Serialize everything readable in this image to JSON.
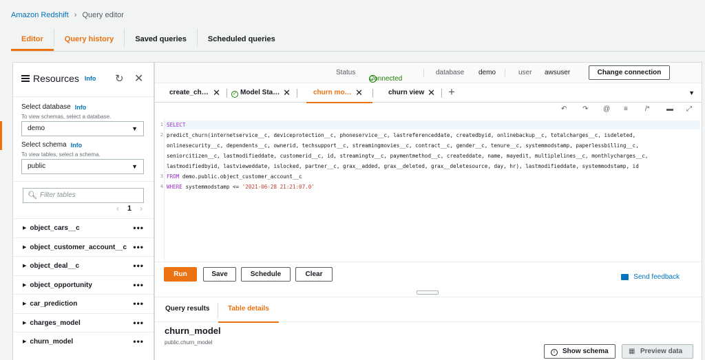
{
  "breadcrumb": {
    "parent": "Amazon Redshift",
    "separator": "›",
    "current": "Query editor"
  },
  "top_tabs": [
    "Editor",
    "Query history",
    "Saved queries",
    "Scheduled queries"
  ],
  "resources": {
    "title": "Resources",
    "info": "Info",
    "select_database_label": "Select database",
    "select_database_desc": "To view schemas, select a database.",
    "database_value": "demo",
    "select_schema_label": "Select schema",
    "select_schema_desc": "To view tables, select a schema.",
    "schema_value": "public",
    "filter_placeholder": "Filter tables",
    "page": "1",
    "tables": [
      "object_cars__c",
      "object_customer_account__c",
      "object_deal__c",
      "object_opportunity",
      "car_prediction",
      "charges_model",
      "churn_model"
    ]
  },
  "status_bar": {
    "status_label": "Status",
    "status_value": "Connected",
    "database_label": "database",
    "database_value": "demo",
    "user_label": "user",
    "user_value": "awsuser",
    "change_connection": "Change connection"
  },
  "query_tabs": [
    {
      "label": "create_ch…"
    },
    {
      "label": "Model Sta…"
    },
    {
      "label": "churn mo…"
    },
    {
      "label": "churn view"
    }
  ],
  "editor": {
    "lines": [
      {
        "num": "1",
        "text": "SELECT"
      },
      {
        "num": "2",
        "text": "predict_churn(internetservice__c, deviceprotection__c, phoneservice__c, lastreferenceddate, createdbyid, onlinebackup__c, totalcharges__c, isdeleted,"
      },
      {
        "num": "",
        "text": "onlinesecurity__c, dependents__c, ownerid, techsupport__c, streamingmovies__c, contract__c, gender__c, tenure__c, systemmodstamp, paperlessbilling__c,"
      },
      {
        "num": "",
        "text": "seniorcitizen__c, lastmodifieddate, customerid__c, id, streamingtv__c, paymentmethod__c, createddate, name, mayedit, multiplelines__c, monthlycharges__c,"
      },
      {
        "num": "",
        "text": "lastmodifiedbyid, lastvieweddate, islocked, partner__c, grax__added, grax__deleted, grax__deletesource, day, hr), lastmodifieddate, systemmodstamp, id"
      },
      {
        "num": "3",
        "kw": "FROM",
        "text": "demo.public.object_customer_account__c"
      },
      {
        "num": "4",
        "kw": "WHERE",
        "text": "systemmodstamp <= ",
        "str": "'2021-06-28 21:21:07.0'"
      }
    ],
    "buttons": {
      "run": "Run",
      "save": "Save",
      "schedule": "Schedule",
      "clear": "Clear"
    },
    "feedback": "Send feedback"
  },
  "results": {
    "tabs": [
      "Query results",
      "Table details"
    ],
    "model_name": "churn_model",
    "model_path": "public.churn_model",
    "show_schema": "Show schema",
    "preview_data": "Preview data"
  },
  "colors": {
    "accent": "#ec7211",
    "link": "#0073bb",
    "success": "#1d8102",
    "keyword": "#9b30c7",
    "string": "#c0392b"
  }
}
